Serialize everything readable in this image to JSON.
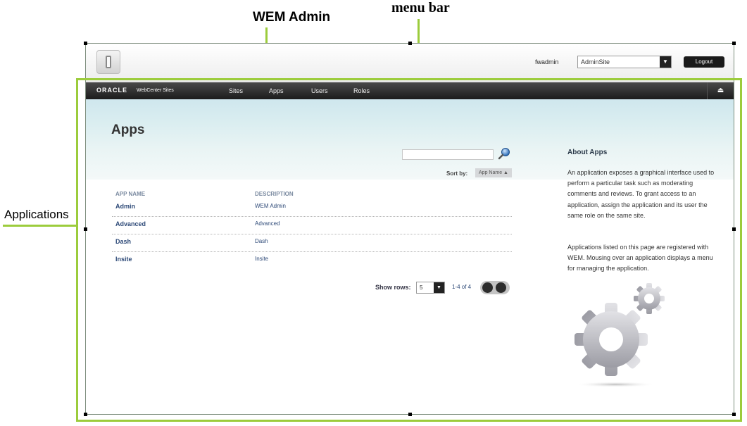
{
  "annotations": {
    "wem_admin": "WEM Admin",
    "menu_bar": "menu bar",
    "applications": "Applications"
  },
  "header": {
    "username": "fwadmin",
    "site_select_value": "AdminSite",
    "logout_label": "Logout"
  },
  "menubar": {
    "brand": "ORACLE",
    "product": "WebCenter Sites",
    "items": [
      "Sites",
      "Apps",
      "Users",
      "Roles"
    ]
  },
  "page": {
    "title": "Apps",
    "search_placeholder": "",
    "sort_by_label": "Sort by:",
    "sort_by_value": "App Name"
  },
  "table": {
    "columns": [
      "APP NAME",
      "DESCRIPTION"
    ],
    "rows": [
      {
        "name": "Admin",
        "description": "WEM Admin"
      },
      {
        "name": "Advanced",
        "description": "Advanced"
      },
      {
        "name": "Dash",
        "description": "Dash"
      },
      {
        "name": "Insite",
        "description": "Insite"
      }
    ]
  },
  "pagination": {
    "show_rows_label": "Show rows:",
    "rows_value": "5",
    "range_text": "1-4 of 4"
  },
  "about": {
    "title": "About Apps",
    "paragraph1": "An application exposes a graphical interface used to perform a particular task such as moderating comments and reviews. To grant access to an application, assign the application and its user the same role on the same site.",
    "paragraph2": "Applications listed on this page are registered with WEM. Mousing over an application displays a menu for managing the application."
  },
  "colors": {
    "callout_green": "#9ccc3c",
    "menubar_dark": "#1c1c1c",
    "link_blue": "#2e4a78"
  }
}
